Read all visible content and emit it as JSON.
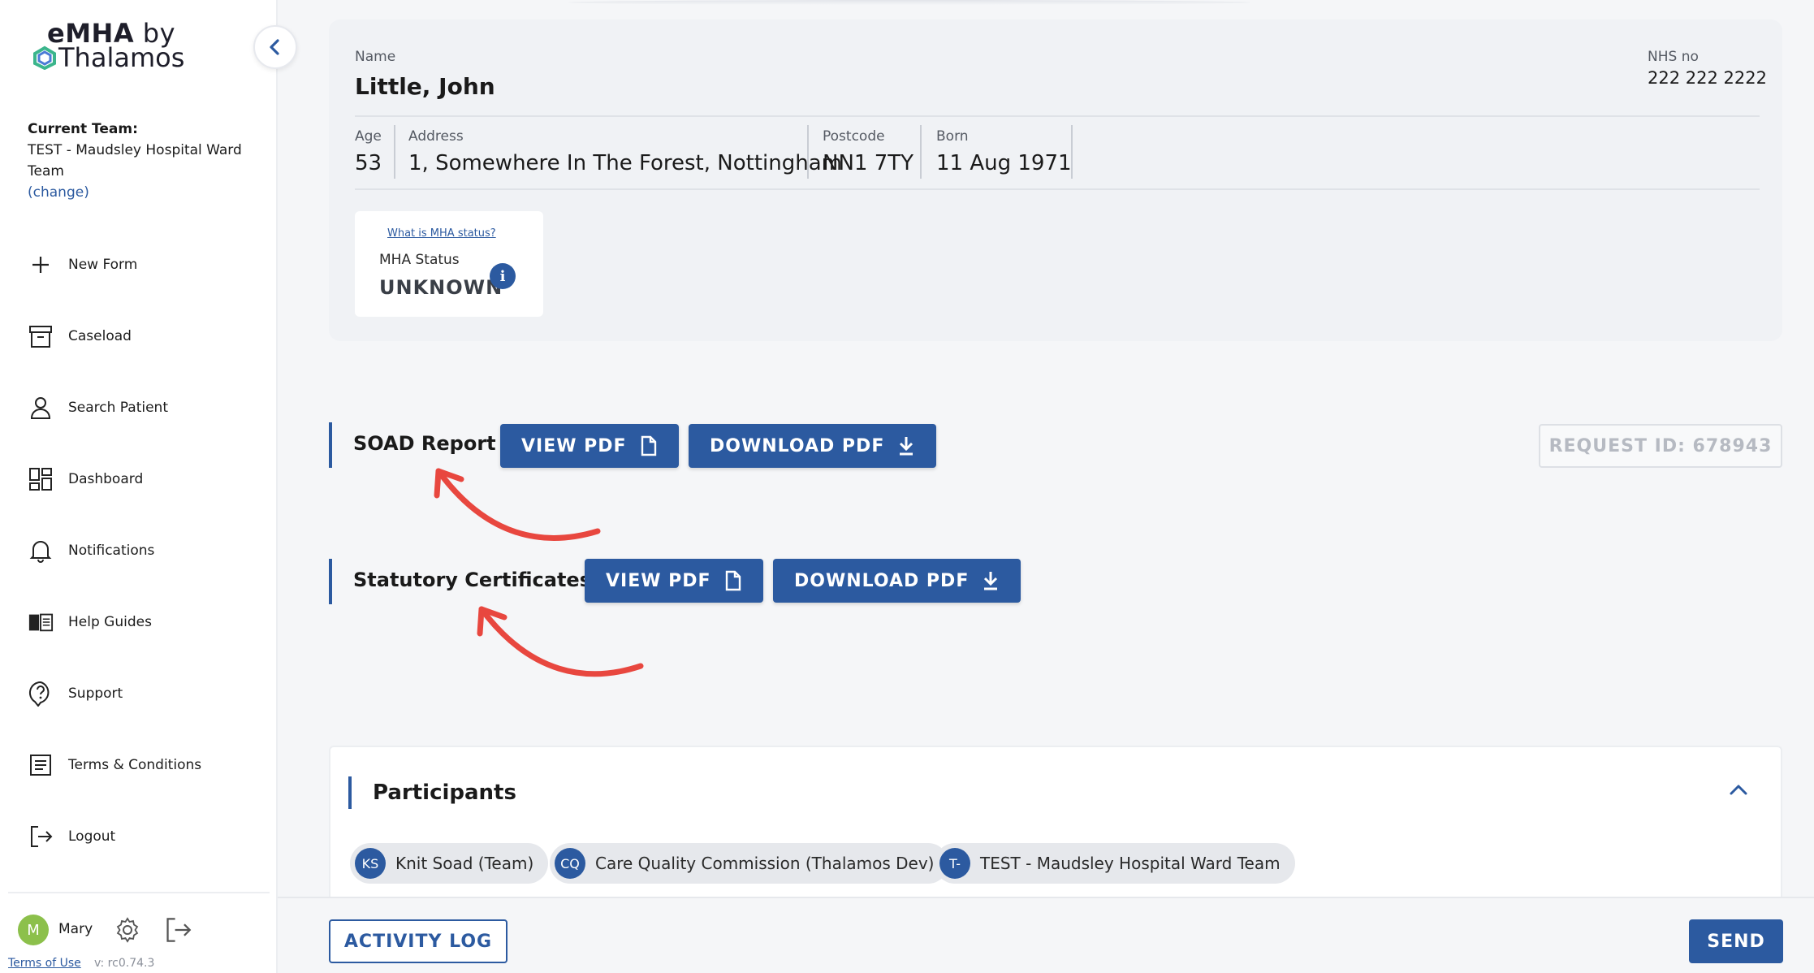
{
  "logo": {
    "line1": "eMHA",
    "line1b": " by",
    "line2": "Thalamos"
  },
  "team": {
    "label": "Current Team:",
    "name": "TEST - Maudsley Hospital Ward Team",
    "change": "(change)"
  },
  "nav": [
    {
      "label": "New Form",
      "icon": "plus-icon"
    },
    {
      "label": "Caseload",
      "icon": "archive-box-icon"
    },
    {
      "label": "Search Patient",
      "icon": "person-icon"
    },
    {
      "label": "Dashboard",
      "icon": "dashboard-grid-icon"
    },
    {
      "label": "Notifications",
      "icon": "bell-icon"
    },
    {
      "label": "Help Guides",
      "icon": "book-icon"
    },
    {
      "label": "Support",
      "icon": "question-bubble-icon"
    },
    {
      "label": "Terms & Conditions",
      "icon": "document-lines-icon"
    },
    {
      "label": "Logout",
      "icon": "logout-icon"
    }
  ],
  "user": {
    "initial": "M",
    "name": "Mary",
    "terms": "Terms of Use",
    "version": "v: rc0.74.3"
  },
  "patient": {
    "name_label": "Name",
    "name": "Little, John",
    "nhs_label": "NHS no",
    "nhs": "222 222 2222",
    "age_label": "Age",
    "age": "53",
    "address_label": "Address",
    "address": "1, Somewhere In The Forest, Nottingham",
    "postcode_label": "Postcode",
    "postcode": "NN1 7TY",
    "born_label": "Born",
    "born": "11 Aug 1971",
    "mha_link": "What is MHA status?",
    "mha_label": "MHA Status",
    "mha_value": "UNKNOWN"
  },
  "soad": {
    "title": "SOAD Report",
    "view": "VIEW PDF",
    "download": "DOWNLOAD PDF",
    "request_id": "REQUEST ID: 678943"
  },
  "certs": {
    "title": "Statutory Certificates",
    "view": "VIEW PDF",
    "download": "DOWNLOAD PDF"
  },
  "participants": {
    "title": "Participants",
    "chips": [
      {
        "initials": "KS",
        "label": "Knit Soad (Team)"
      },
      {
        "initials": "CQ",
        "label": "Care Quality Commission (Thalamos Dev)"
      },
      {
        "initials": "T-",
        "label": "TEST - Maudsley Hospital Ward Team"
      }
    ]
  },
  "footer": {
    "activity": "ACTIVITY LOG",
    "send": "SEND"
  },
  "colors": {
    "primary": "#2c5aa0",
    "annotation": "#e8473f",
    "avatar": "#8cc04b"
  }
}
